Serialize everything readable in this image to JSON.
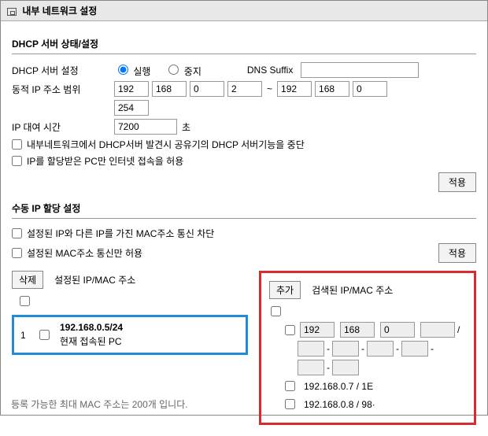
{
  "page_title": "내부 네트워크 설정",
  "section1_title": "DHCP 서버 상태/설정",
  "labels": {
    "dhcp_server": "DHCP 서버 설정",
    "dynamic_range": "동적 IP 주소 범위",
    "lease_time": "IP 대여 시간",
    "dns_suffix": "DNS Suffix",
    "radio_run": "실행",
    "radio_stop": "중지",
    "seconds": "초",
    "tilde": "~",
    "slash": "/",
    "dash": "-"
  },
  "dhcp": {
    "state": "run",
    "range_start": [
      "192",
      "168",
      "0",
      "2"
    ],
    "range_end": [
      "192",
      "168",
      "0",
      "254"
    ],
    "lease": "7200",
    "dns_suffix": ""
  },
  "chk1": "내부네트워크에서 DHCP서버 발견시 공유기의 DHCP 서버기능을 중단",
  "chk2": "IP를 할당받은 PC만 인터넷 접속을 허용",
  "btn_apply": "적용",
  "section2_title": "수동 IP 할당 설정",
  "chk3": "설정된 IP와 다른 IP를 가진 MAC주소 통신 차단",
  "chk4": "설정된 MAC주소 통신만 허용",
  "btn_delete": "삭제",
  "btn_add": "추가",
  "left_header": "설정된 IP/MAC 주소",
  "right_header": "검색된 IP/MAC 주소",
  "selected": {
    "num": "1",
    "ip": "192.168.0.5/24",
    "desc": "현재 접속된 PC"
  },
  "search_ip": [
    "192",
    "168",
    "0",
    ""
  ],
  "search_mac": [
    "",
    "",
    "",
    "",
    "",
    ""
  ],
  "found": [
    "192.168.0.7 / 1E",
    "192.168.0.8 / 98·"
  ],
  "footer": "등록 가능한 최대 MAC 주소는 200개 입니다."
}
